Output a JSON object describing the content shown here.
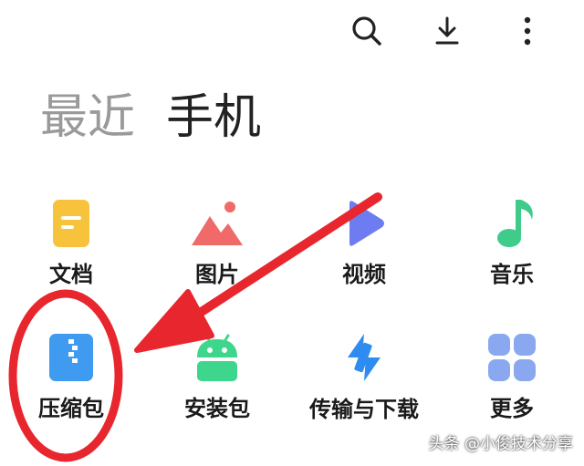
{
  "toolbar": {
    "search_icon": "search-icon",
    "download_icon": "download-icon",
    "more_icon": "more-vertical-icon"
  },
  "tabs": {
    "recent": "最近",
    "phone": "手机"
  },
  "categories": [
    {
      "label": "文档",
      "icon": "document-icon",
      "color": "#F7C23C"
    },
    {
      "label": "图片",
      "icon": "image-icon",
      "color": "#F06A6A"
    },
    {
      "label": "视频",
      "icon": "video-icon",
      "color": "#6D7CF0"
    },
    {
      "label": "音乐",
      "icon": "music-icon",
      "color": "#3FCB8A"
    },
    {
      "label": "压缩包",
      "icon": "archive-icon",
      "color": "#3E9BF0"
    },
    {
      "label": "安装包",
      "icon": "android-icon",
      "color": "#3DD68C"
    },
    {
      "label": "传输与下载",
      "icon": "transfer-icon",
      "color": "#2E8CF0"
    },
    {
      "label": "更多",
      "icon": "grid-more-icon",
      "color": "#8AA8F0"
    }
  ],
  "watermark": "头条 @小俊技术分享",
  "annotation": {
    "color": "#E8262D"
  }
}
